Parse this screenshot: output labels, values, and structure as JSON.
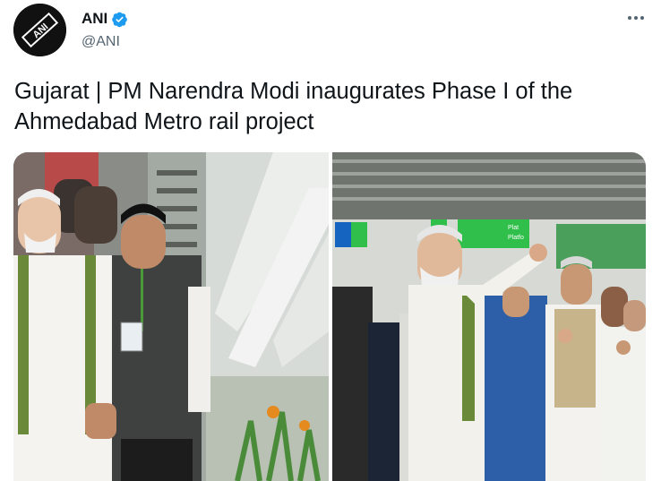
{
  "account": {
    "display_name": "ANI",
    "handle": "@ANI",
    "verified": true,
    "avatar_logo_text": "ANI",
    "more_icon": "ellipsis-icon"
  },
  "tweet": {
    "text": "Gujarat | PM Narendra Modi inaugurates Phase I of the Ahmedabad Metro rail project"
  },
  "media": {
    "photo_count": 2,
    "right_photo_signage": [
      "Plat",
      "Platfo"
    ]
  },
  "colors": {
    "verified_blue": "#1d9bf0",
    "sign_green": "#2fbf4a",
    "sign_blue": "#1565c0",
    "secondary_text": "#536471"
  }
}
